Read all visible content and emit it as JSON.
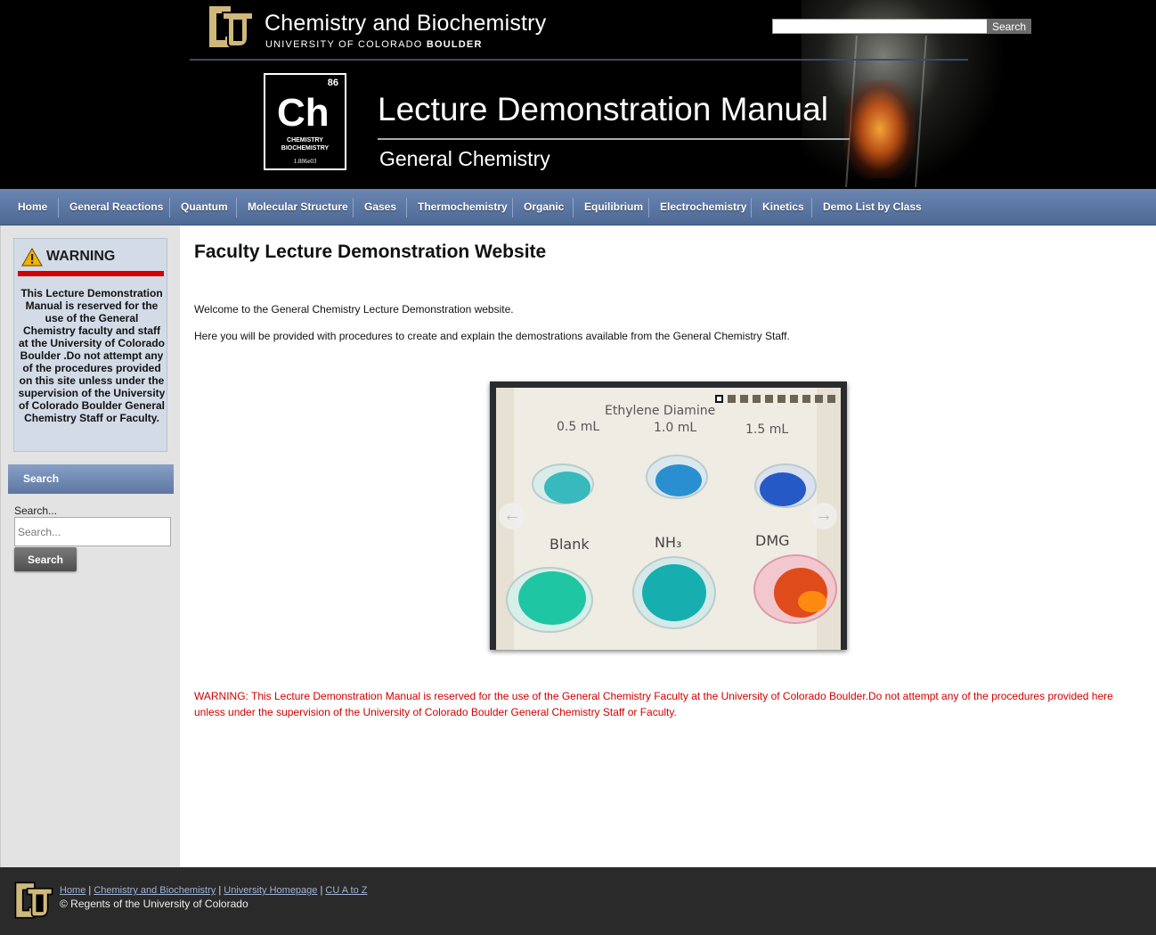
{
  "header": {
    "dept_title": "Chemistry and Biochemistry",
    "dept_sub_pre": "UNIVERSITY OF COLORADO ",
    "dept_sub_bold": "BOULDER",
    "search_button": "Search",
    "element": {
      "number": "86",
      "symbol": "Ch",
      "name_line1": "CHEMISTRY",
      "name_line2": "BIOCHEMISTRY",
      "mass": "1.886e03"
    },
    "manual_title": "Lecture Demonstration Manual",
    "manual_sub": "General Chemistry"
  },
  "nav": {
    "items": [
      "Home",
      "General Reactions",
      "Quantum",
      "Molecular Structure",
      "Gases",
      "Thermochemistry",
      "Organic",
      "Equilibrium",
      "Electrochemistry",
      "Kinetics",
      "Demo List by Class"
    ]
  },
  "sidebar": {
    "warning_title": "WARNING",
    "warning_text": "This Lecture Demonstration Manual is reserved for the use of the General Chemistry faculty and staff at the University of Colorado Boulder .Do not attempt any of the procedures provided on this site unless under the supervision of the University of Colorado Boulder General Chemistry Staff or Faculty.",
    "search_header": "Search",
    "search_label": "Search...",
    "search_placeholder": "Search...",
    "search_button": "Search"
  },
  "main": {
    "title": "Faculty Lecture Demonstration Website",
    "paragraph1": "Welcome to the General Chemistry Lecture Demonstration website.",
    "paragraph2": "Here you will be provided with procedures to create and explain the demostrations available from the General Chemistry Staff.",
    "slider": {
      "slide_count": 10,
      "active_index": 0,
      "labels": {
        "top_title": "Ethylene Diamine",
        "v1": "0.5 mL",
        "v2": "1.0 mL",
        "v3": "1.5 mL",
        "blank": "Blank",
        "nh3": "NH₃",
        "dmg": "DMG"
      }
    },
    "warning_red": "WARNING: This Lecture Demonstration Manual is reserved for the use of the General Chemistry Faculty at the University of Colorado Boulder.Do not attempt any of the procedures provided here unless under the supervision of the University of Colorado Boulder General Chemistry Staff or Faculty."
  },
  "footer": {
    "links": [
      "Home",
      "Chemistry and Biochemistry",
      "University Homepage",
      "CU A to Z"
    ],
    "separator": "|",
    "copyright": "© Regents of the University of Colorado"
  },
  "colors": {
    "nav_bg": "#5a76a3",
    "warning_red": "#d10000",
    "cu_gold": "#cfb87c",
    "footer_bg": "#2a2a2a"
  }
}
